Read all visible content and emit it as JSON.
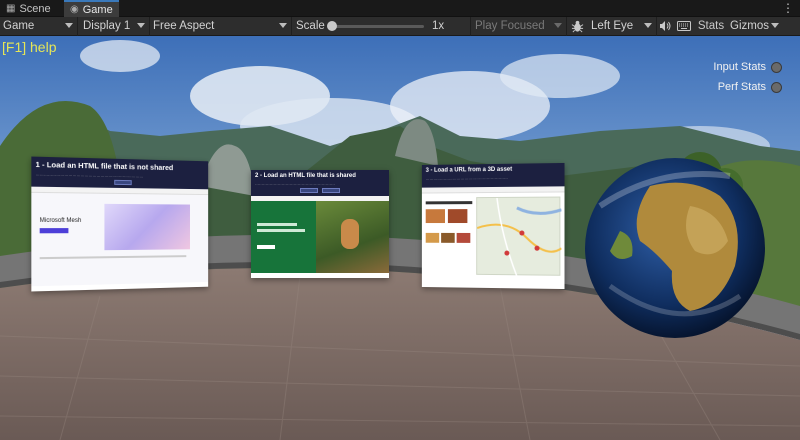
{
  "tabs": [
    {
      "label": "Scene",
      "icon": "scene-icon",
      "active": false
    },
    {
      "label": "Game",
      "icon": "game-icon",
      "active": true
    }
  ],
  "toolbar": {
    "view_mode": "Game",
    "display": "Display 1",
    "aspect": "Free Aspect",
    "scale_label": "Scale",
    "scale_value": "1x",
    "play_mode": "Play Focused",
    "eye": "Left Eye",
    "stats_label": "Stats",
    "gizmos_label": "Gizmos"
  },
  "viewport": {
    "help_text": "[F1] help",
    "input_stats_label": "Input Stats",
    "perf_stats_label": "Perf Stats",
    "panels": [
      {
        "title": "1 - Load an HTML file that is not shared",
        "brand": "Microsoft Mesh"
      },
      {
        "title": "2 - Load an HTML file that is shared"
      },
      {
        "title": "3 - Load a URL from a 3D asset"
      }
    ]
  },
  "colors": {
    "accent": "#3a79bb",
    "help_text": "#e6e657"
  }
}
